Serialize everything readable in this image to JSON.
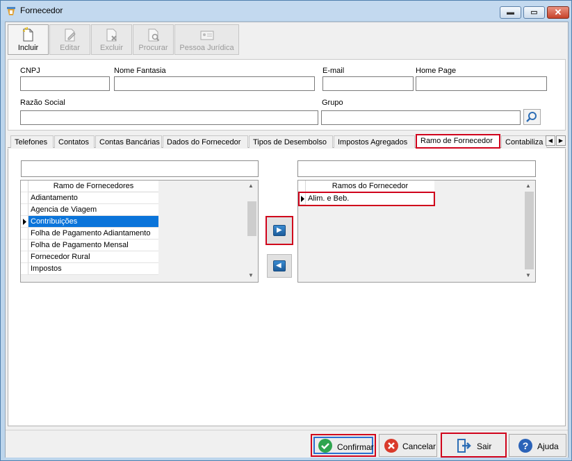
{
  "window": {
    "title": "Fornecedor",
    "min_glyph": "▬",
    "max_glyph": "▭",
    "close_glyph": "✕"
  },
  "toolbar": {
    "buttons": [
      {
        "label": "Incluir",
        "icon": "new-document-icon",
        "enabled": true
      },
      {
        "label": "Editar",
        "icon": "edit-document-icon",
        "enabled": false
      },
      {
        "label": "Excluir",
        "icon": "delete-document-icon",
        "enabled": false
      },
      {
        "label": "Procurar",
        "icon": "search-document-icon",
        "enabled": false
      },
      {
        "label": "Pessoa Jurídica",
        "icon": "id-card-icon",
        "enabled": false
      }
    ]
  },
  "form": {
    "cnpj_label": "CNPJ",
    "cnpj_value": "",
    "nome_fantasia_label": "Nome Fantasia",
    "nome_fantasia_value": "",
    "email_label": "E-mail",
    "email_value": "",
    "homepage_label": "Home Page",
    "homepage_value": "",
    "razao_social_label": "Razão Social",
    "razao_social_value": "",
    "grupo_label": "Grupo",
    "grupo_value": ""
  },
  "tabs": [
    "Telefones",
    "Contatos",
    "Contas Bancárias",
    "Dados do Fornecedor",
    "Tipos de Desembolso",
    "Impostos Agregados",
    "Ramo de Fornecedor",
    "Contabiliza"
  ],
  "active_tab": "Ramo de Fornecedor",
  "tab_scroll": {
    "left": "◀",
    "right": "▶"
  },
  "available_grid": {
    "header": "Ramo de Fornecedores",
    "filter_value": "",
    "rows": [
      "Adiantamento",
      "Agencia de Viagem",
      "Contribuições",
      "Folha de Pagamento Adiantamento",
      "Folha de Pagamento Mensal",
      "Fornecedor Rural",
      "Impostos"
    ],
    "selected": "Contribuições"
  },
  "assigned_grid": {
    "header": "Ramos do Fornecedor",
    "filter_value": "",
    "rows": [
      "Alim. e Beb."
    ]
  },
  "move_buttons": {
    "add_glyph": "▶",
    "remove_glyph": "◀"
  },
  "bottom": {
    "confirmar": "Confirmar",
    "cancelar": "Cancelar",
    "sair": "Sair",
    "ajuda": "Ajuda"
  },
  "colors": {
    "highlight": "#d0021b",
    "selection": "#0a74da",
    "accent_blue": "#2a6fd0"
  }
}
